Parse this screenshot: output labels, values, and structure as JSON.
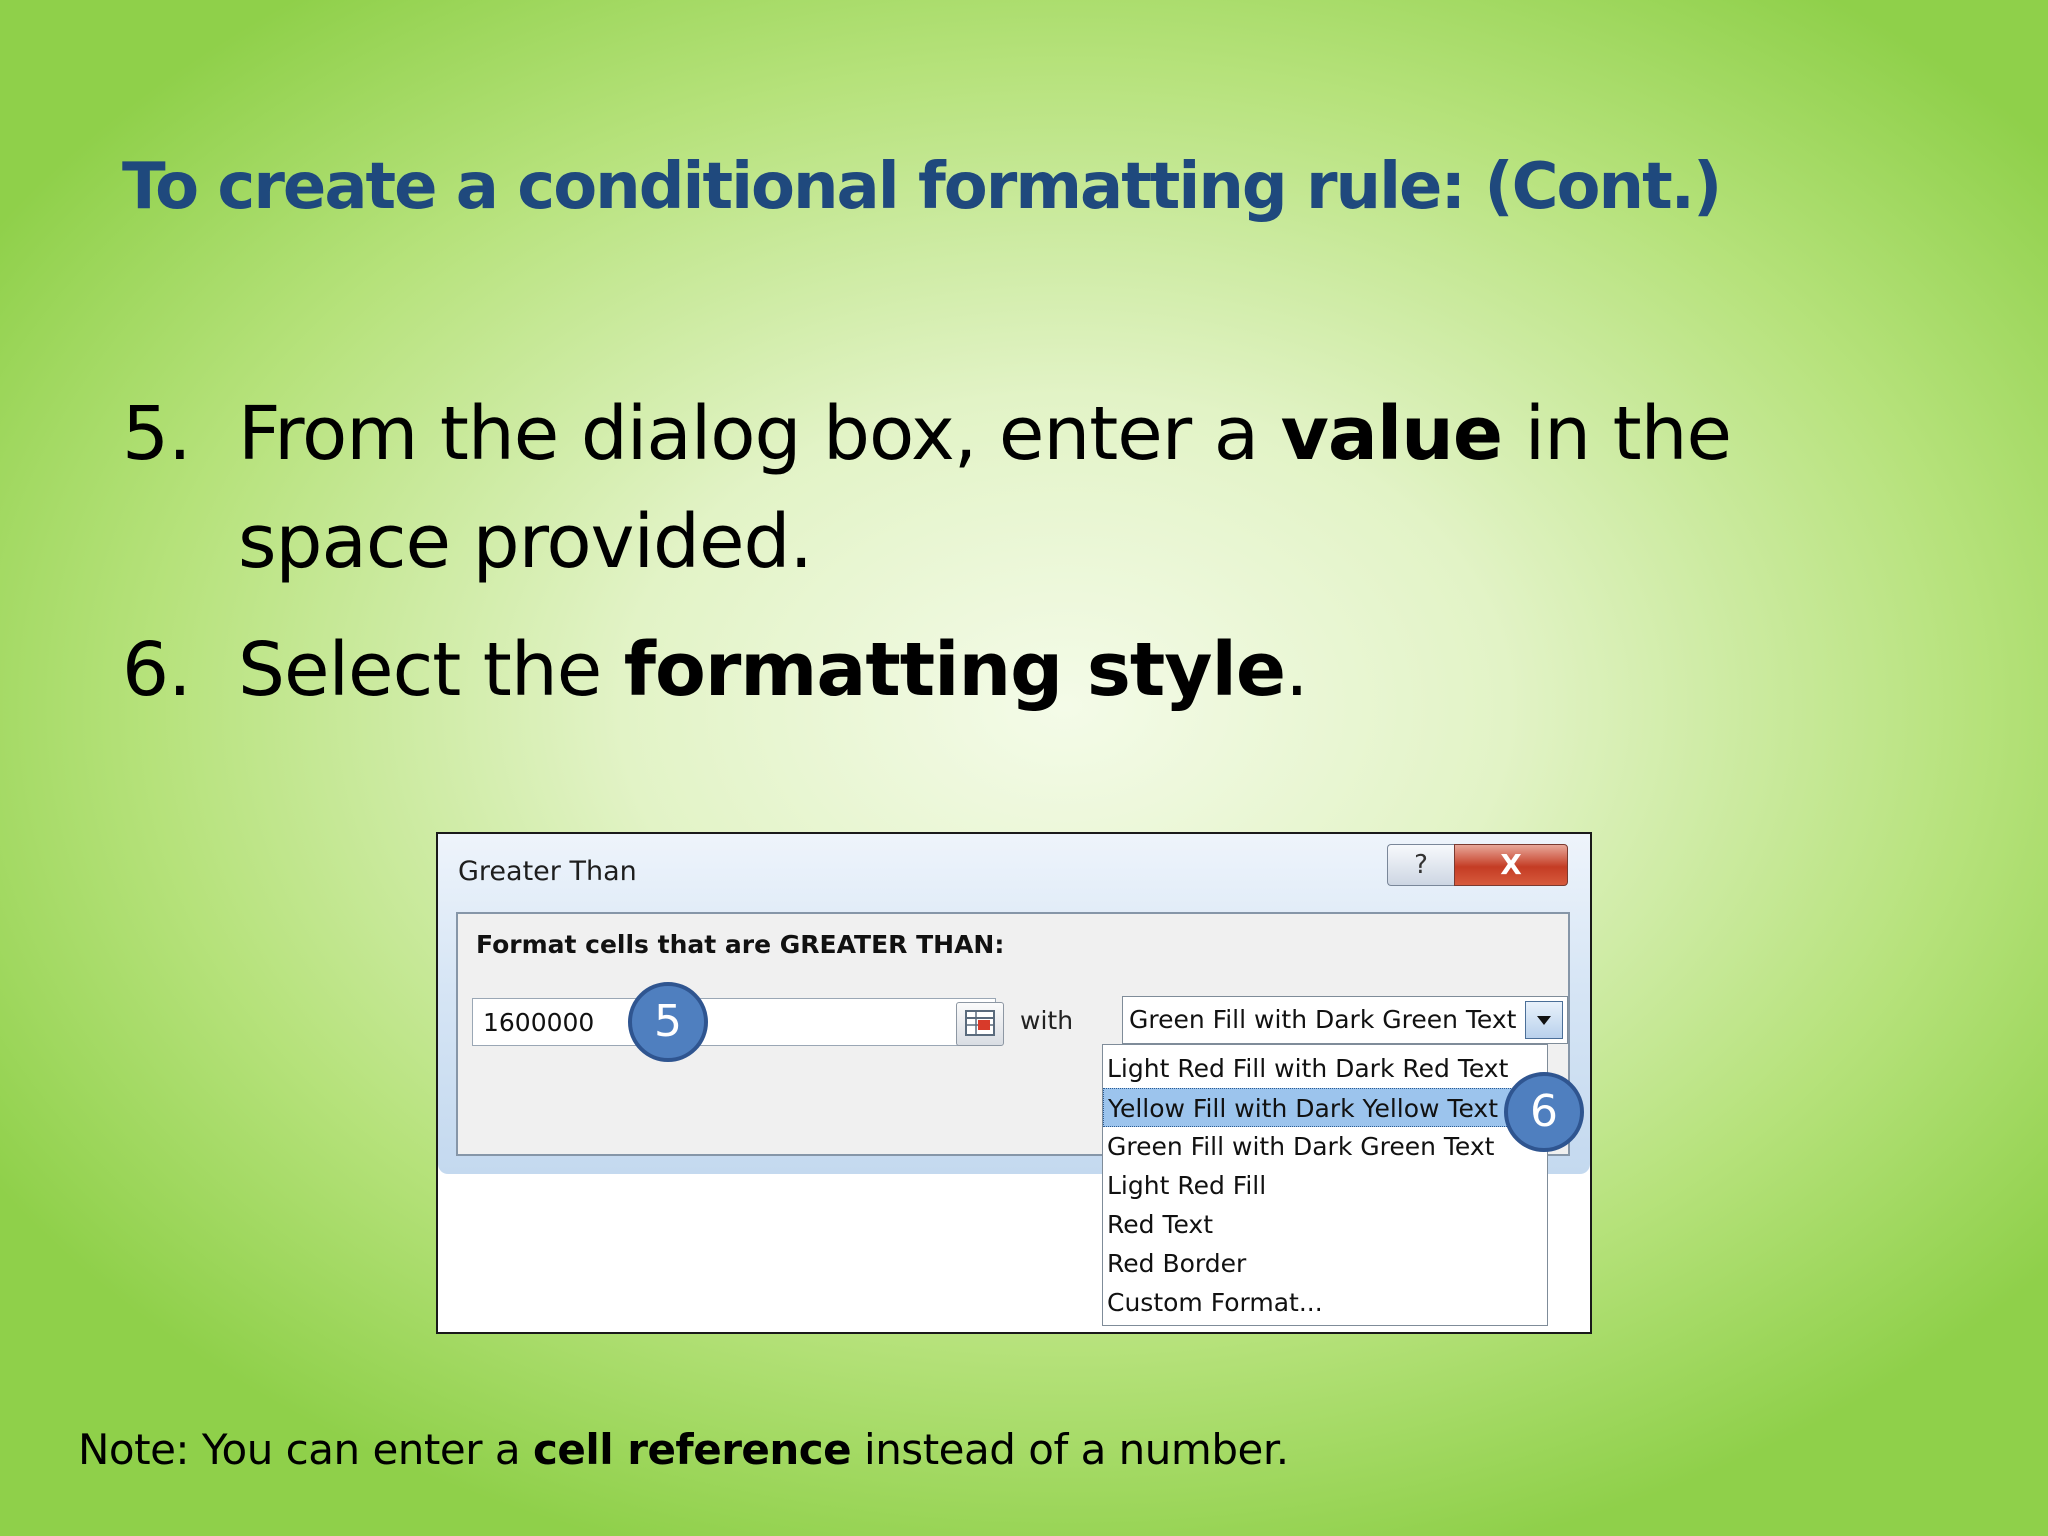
{
  "slide": {
    "title": "To create a conditional formatting rule: (Cont.)",
    "steps": [
      {
        "number": "5.",
        "pre": "From the dialog box, enter a ",
        "bold": "value",
        "post": " in the space provided."
      },
      {
        "number": "6.",
        "pre": "Select the ",
        "bold": "formatting style",
        "post": "."
      }
    ],
    "note": {
      "pre": "Note: You can enter a ",
      "bold": "cell reference",
      "post": " instead of a number."
    }
  },
  "dialog": {
    "title": "Greater Than",
    "help_label": "?",
    "close_label": "X",
    "prompt": "Format cells that are GREATER THAN:",
    "value": "1600000",
    "with_label": "with",
    "selected_style": "Green Fill with Dark Green Text",
    "options": [
      "Light Red Fill with Dark Red Text",
      "Yellow Fill with Dark Yellow Text",
      "Green Fill with Dark Green Text",
      "Light Red Fill",
      "Red Text",
      "Red Border",
      "Custom Format..."
    ],
    "highlighted_option_index": 1
  },
  "callouts": {
    "value_step": "5",
    "style_step": "6"
  },
  "colors": {
    "title": "#1f497d",
    "callout": "#4f7fbf",
    "highlight": "#9cc4ed"
  }
}
